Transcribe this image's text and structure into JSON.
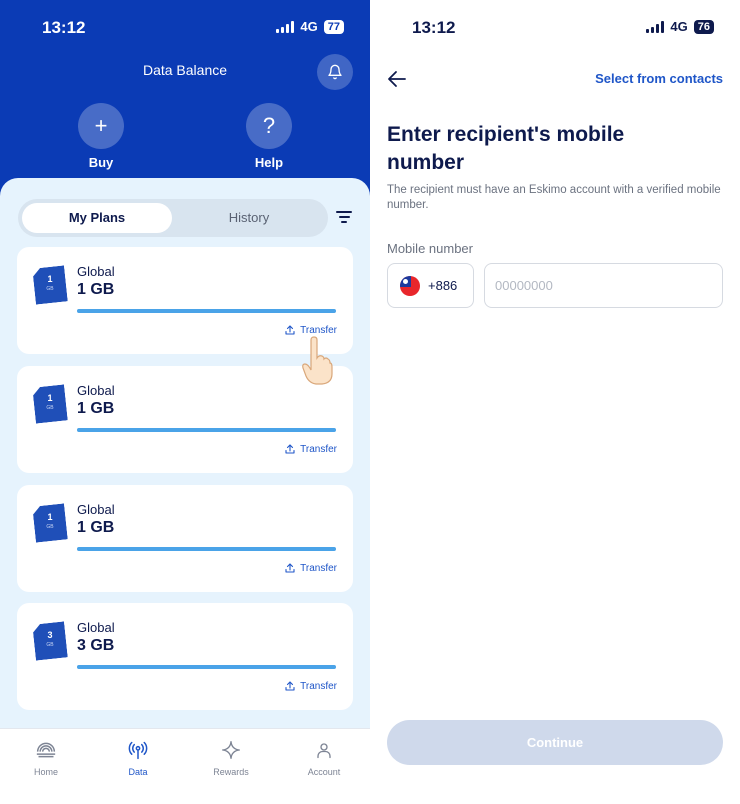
{
  "left": {
    "status": {
      "time": "13:12",
      "network": "4G",
      "battery": "77"
    },
    "header": {
      "title": "Data Balance"
    },
    "actions": [
      {
        "label": "Buy",
        "icon": "+"
      },
      {
        "label": "Help",
        "icon": "?"
      }
    ],
    "tabs": {
      "active": "My Plans",
      "inactive": "History"
    },
    "plans": [
      {
        "sim_number": "1",
        "sim_unit": "GB",
        "name": "Global",
        "size": "1 GB",
        "remaining": 1.0,
        "transfer_label": "Transfer"
      },
      {
        "sim_number": "1",
        "sim_unit": "GB",
        "name": "Global",
        "size": "1 GB",
        "remaining": 1.0,
        "transfer_label": "Transfer"
      },
      {
        "sim_number": "1",
        "sim_unit": "GB",
        "name": "Global",
        "size": "1 GB",
        "remaining": 1.0,
        "transfer_label": "Transfer"
      },
      {
        "sim_number": "3",
        "sim_unit": "GB",
        "name": "Global",
        "size": "3 GB",
        "remaining": 1.0,
        "transfer_label": "Transfer"
      }
    ],
    "tabbar": [
      {
        "label": "Home",
        "active": false
      },
      {
        "label": "Data",
        "active": true
      },
      {
        "label": "Rewards",
        "active": false
      },
      {
        "label": "Account",
        "active": false
      }
    ]
  },
  "right": {
    "status": {
      "time": "13:12",
      "network": "4G",
      "battery": "76"
    },
    "select_contacts": "Select from contacts",
    "heading": "Enter recipient's mobile number",
    "description": "The recipient must have an Eskimo account with a verified mobile number.",
    "field_label": "Mobile number",
    "country_code": "+886",
    "phone_placeholder": "00000000",
    "continue_label": "Continue"
  },
  "colors": {
    "brand_blue": "#0b3bb5",
    "accent_link": "#1f56c8",
    "progress": "#4aa3e8"
  }
}
